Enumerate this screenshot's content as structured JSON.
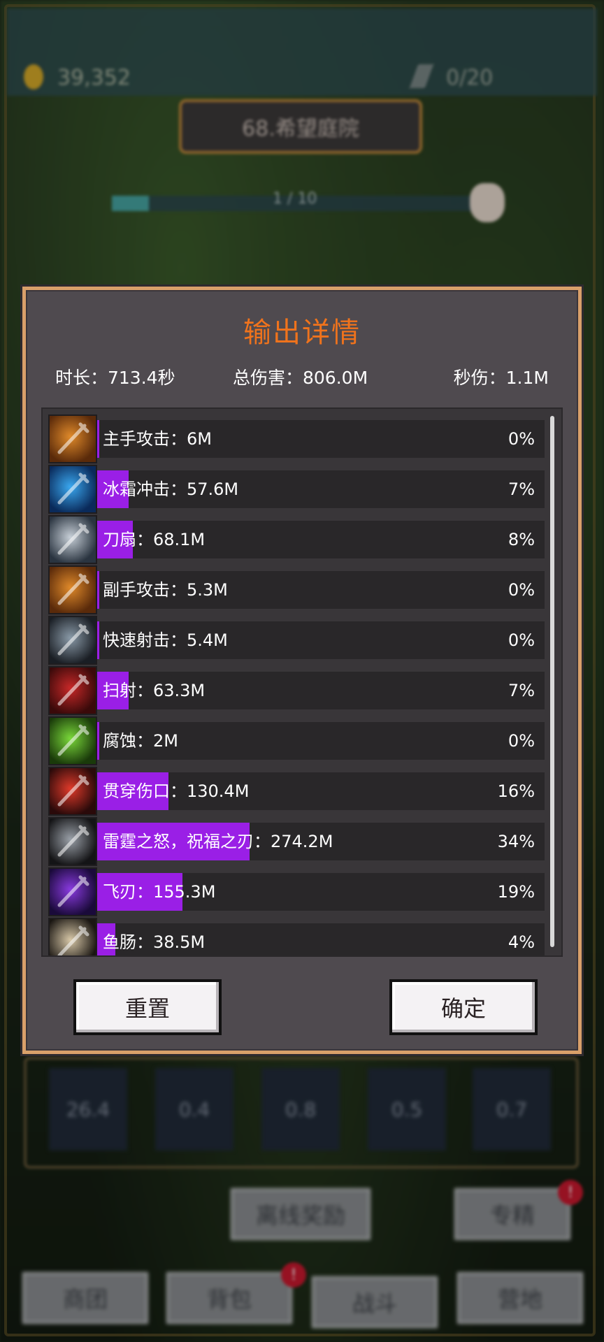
{
  "hud": {
    "gold": "39,352",
    "quill_count": "0/20",
    "stage_name": "68.希望庭院",
    "stage_progress": "1 / 10",
    "stage_progress_fraction": 0.1
  },
  "dialog": {
    "title": "输出详情",
    "duration": "时长：713.4秒",
    "total_damage": "总伤害：806.0M",
    "dps": "秒伤：1.1M",
    "rows": [
      {
        "label": "主手攻击：6M",
        "pct": "0%",
        "fill": 0.005,
        "icon": "sword-icon",
        "c1": "#e08a2a",
        "c2": "#5a2a0a"
      },
      {
        "label": "冰霜冲击：57.6M",
        "pct": "7%",
        "fill": 0.07,
        "icon": "ice-crystal-icon",
        "c1": "#3aa8f0",
        "c2": "#0a2a5a"
      },
      {
        "label": "刀扇：68.1M",
        "pct": "8%",
        "fill": 0.08,
        "icon": "blade-fan-icon",
        "c1": "#c8d0d8",
        "c2": "#2a3440"
      },
      {
        "label": "副手攻击：5.3M",
        "pct": "0%",
        "fill": 0.005,
        "icon": "sword-icon",
        "c1": "#e08a2a",
        "c2": "#5a2a0a"
      },
      {
        "label": "快速射击：5.4M",
        "pct": "0%",
        "fill": 0.005,
        "icon": "arrow-icon",
        "c1": "#8a9aa8",
        "c2": "#1a1e24"
      },
      {
        "label": "扫射：63.3M",
        "pct": "7%",
        "fill": 0.07,
        "icon": "crossbow-icon",
        "c1": "#c82828",
        "c2": "#3a0a0a"
      },
      {
        "label": "腐蚀：2M",
        "pct": "0%",
        "fill": 0.003,
        "icon": "poison-skull-icon",
        "c1": "#7ad83a",
        "c2": "#1a3a0a"
      },
      {
        "label": "贯穿伤口：130.4M",
        "pct": "16%",
        "fill": 0.16,
        "icon": "curved-blade-icon",
        "c1": "#e03a2a",
        "c2": "#2a0a0a"
      },
      {
        "label": "雷霆之怒，祝福之刃：274.2M",
        "pct": "34%",
        "fill": 0.34,
        "icon": "thunderfury-sword-icon",
        "c1": "#9aa0a8",
        "c2": "#141416"
      },
      {
        "label": "飞刃：155.3M",
        "pct": "19%",
        "fill": 0.19,
        "icon": "flying-blade-icon",
        "c1": "#8a3ae0",
        "c2": "#1a0a3a"
      },
      {
        "label": "鱼肠：38.5M",
        "pct": "4%",
        "fill": 0.04,
        "icon": "dagger-icon",
        "c1": "#d8c8a8",
        "c2": "#1a1612"
      }
    ],
    "reset_label": "重置",
    "confirm_label": "确定"
  },
  "skill_slots": [
    "26.4",
    "0.4",
    "0.8",
    "0.5",
    "0.7"
  ],
  "bottom": {
    "offline_reward": "离线奖励",
    "specialization": "专精",
    "nav": [
      "商团",
      "背包",
      "战斗",
      "营地"
    ],
    "badge": "!"
  },
  "colors": {
    "accent": "#f0731c",
    "bar_fill": "#9a1fe6",
    "border": "#d9a06a"
  }
}
